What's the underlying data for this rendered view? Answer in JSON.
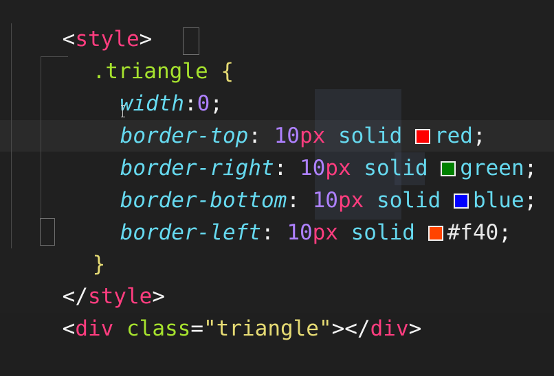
{
  "code": {
    "lines": [
      {
        "open": "<",
        "tag": "style",
        "close": ">"
      },
      {
        "selector": ".triangle",
        "brace": "{"
      },
      {
        "prop": "width",
        "colon": ":",
        "num": "0",
        "semi": ";"
      },
      {
        "prop": "border-top",
        "colon": ":",
        "num": "10",
        "unit": "px",
        "style": "solid",
        "color_name": "red",
        "swatch": "#ff0000",
        "end": ";"
      },
      {
        "prop": "border-right",
        "colon": ":",
        "num": "10",
        "unit": "px",
        "style": "solid",
        "color_name": "green",
        "swatch": "#008000",
        "end": ";"
      },
      {
        "prop": "border-bottom",
        "colon": ":",
        "num": "10",
        "unit": "px",
        "style": "solid",
        "color_name": "blue",
        "swatch": "#0000ff",
        "end": ";"
      },
      {
        "prop": "border-left",
        "colon": ":",
        "num": "10",
        "unit": "px",
        "style": "solid",
        "color_name": "#f40",
        "swatch": "#ff4400",
        "end": ";"
      },
      {
        "brace": "}"
      },
      {
        "open": "</",
        "tag": "style",
        "close": ">"
      },
      {
        "open": "<",
        "tag": "div",
        "attr": "class",
        "eq": "=",
        "value": "\"triangle\"",
        "close": "></",
        "tag2": "div",
        "end": ">"
      }
    ]
  },
  "colors": {
    "background": "#202020",
    "tag": "#ff3d7f",
    "selector": "#a6e22e",
    "property": "#66d9ef",
    "number": "#ae81ff",
    "string": "#e6db74"
  }
}
